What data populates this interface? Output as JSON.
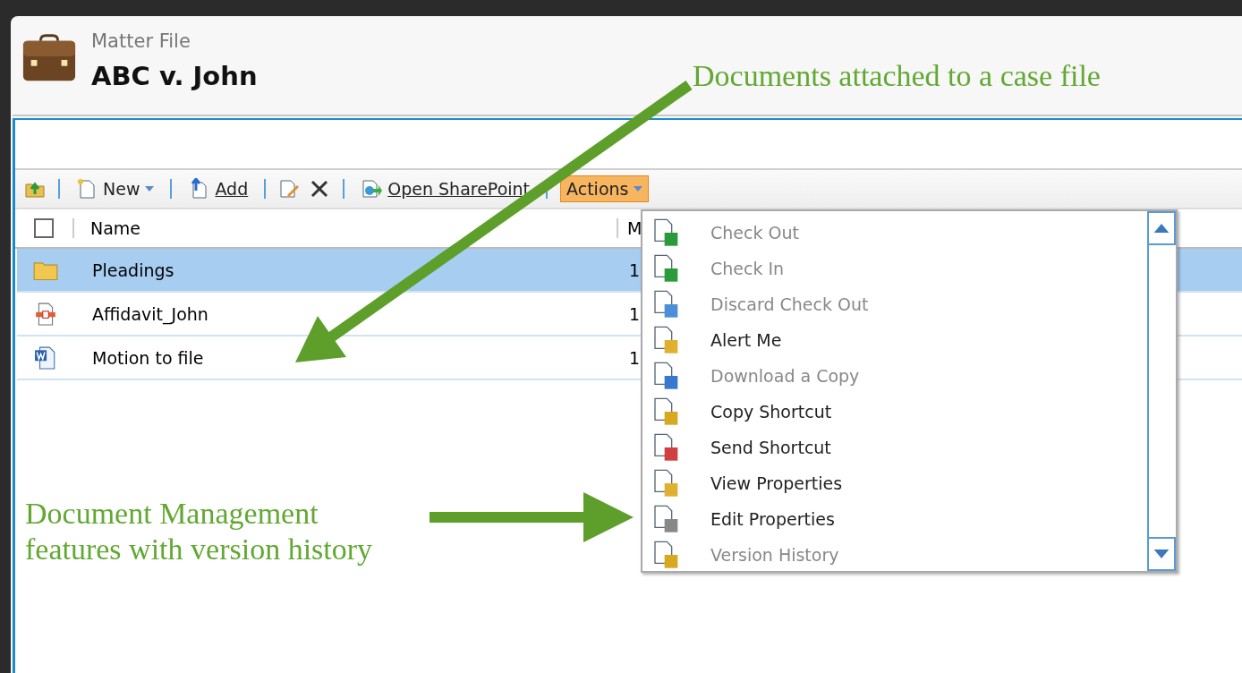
{
  "header": {
    "subtitle": "Matter File",
    "title": "ABC v. John"
  },
  "toolbar": {
    "new": "New",
    "add": "Add",
    "open_sharepoint": "Open SharePoint",
    "actions": {
      "label": "Actions",
      "expanded": true
    }
  },
  "table": {
    "select_all": {
      "checked": false
    },
    "columns": [
      "Name",
      "M"
    ],
    "rows": [
      {
        "kind": "folder",
        "name": "Pleadings",
        "column_2": "1",
        "selected": true
      },
      {
        "kind": "pdf",
        "name": "Affidavit_John",
        "column_2": "1",
        "selected": false
      },
      {
        "kind": "word",
        "name": "Motion to file",
        "column_2": "1",
        "selected": false
      }
    ]
  },
  "actions_menu": [
    {
      "label": "Check Out",
      "disabled": true
    },
    {
      "label": "Check In",
      "disabled": true
    },
    {
      "label": "Discard Check Out",
      "disabled": true
    },
    {
      "label": "Alert Me",
      "disabled": false
    },
    {
      "label": "Download a Copy",
      "disabled": true
    },
    {
      "label": "Copy Shortcut",
      "disabled": false
    },
    {
      "label": "Send Shortcut",
      "disabled": false
    },
    {
      "label": "View Properties",
      "disabled": false
    },
    {
      "label": "Edit Properties",
      "disabled": false
    },
    {
      "label": "Version History",
      "disabled": true
    }
  ],
  "annotations": [
    "Documents attached to a case file",
    "Document Management features with version history"
  ]
}
